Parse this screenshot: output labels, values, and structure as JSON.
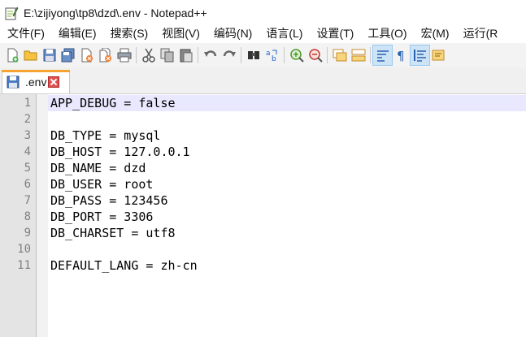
{
  "window": {
    "title": "E:\\zijiyong\\tp8\\dzd\\.env - Notepad++"
  },
  "menu": [
    {
      "label": "文件(F)"
    },
    {
      "label": "编辑(E)"
    },
    {
      "label": "搜索(S)"
    },
    {
      "label": "视图(V)"
    },
    {
      "label": "编码(N)"
    },
    {
      "label": "语言(L)"
    },
    {
      "label": "设置(T)"
    },
    {
      "label": "工具(O)"
    },
    {
      "label": "宏(M)"
    },
    {
      "label": "运行(R"
    }
  ],
  "tabs": [
    {
      "label": ".env"
    }
  ],
  "editor": {
    "current_line": 1,
    "lines": [
      {
        "num": "1",
        "text": "APP_DEBUG = false"
      },
      {
        "num": "2",
        "text": ""
      },
      {
        "num": "3",
        "text": "DB_TYPE = mysql"
      },
      {
        "num": "4",
        "text": "DB_HOST = 127.0.0.1"
      },
      {
        "num": "5",
        "text": "DB_NAME = dzd"
      },
      {
        "num": "6",
        "text": "DB_USER = root"
      },
      {
        "num": "7",
        "text": "DB_PASS = 123456"
      },
      {
        "num": "8",
        "text": "DB_PORT = 3306"
      },
      {
        "num": "9",
        "text": "DB_CHARSET = utf8"
      },
      {
        "num": "10",
        "text": ""
      },
      {
        "num": "11",
        "text": "DEFAULT_LANG = zh-cn"
      }
    ]
  },
  "colors": {
    "accent_tab": "#f6a431",
    "current_line": "#e8e8ff",
    "gutter": "#e4e4e4"
  }
}
